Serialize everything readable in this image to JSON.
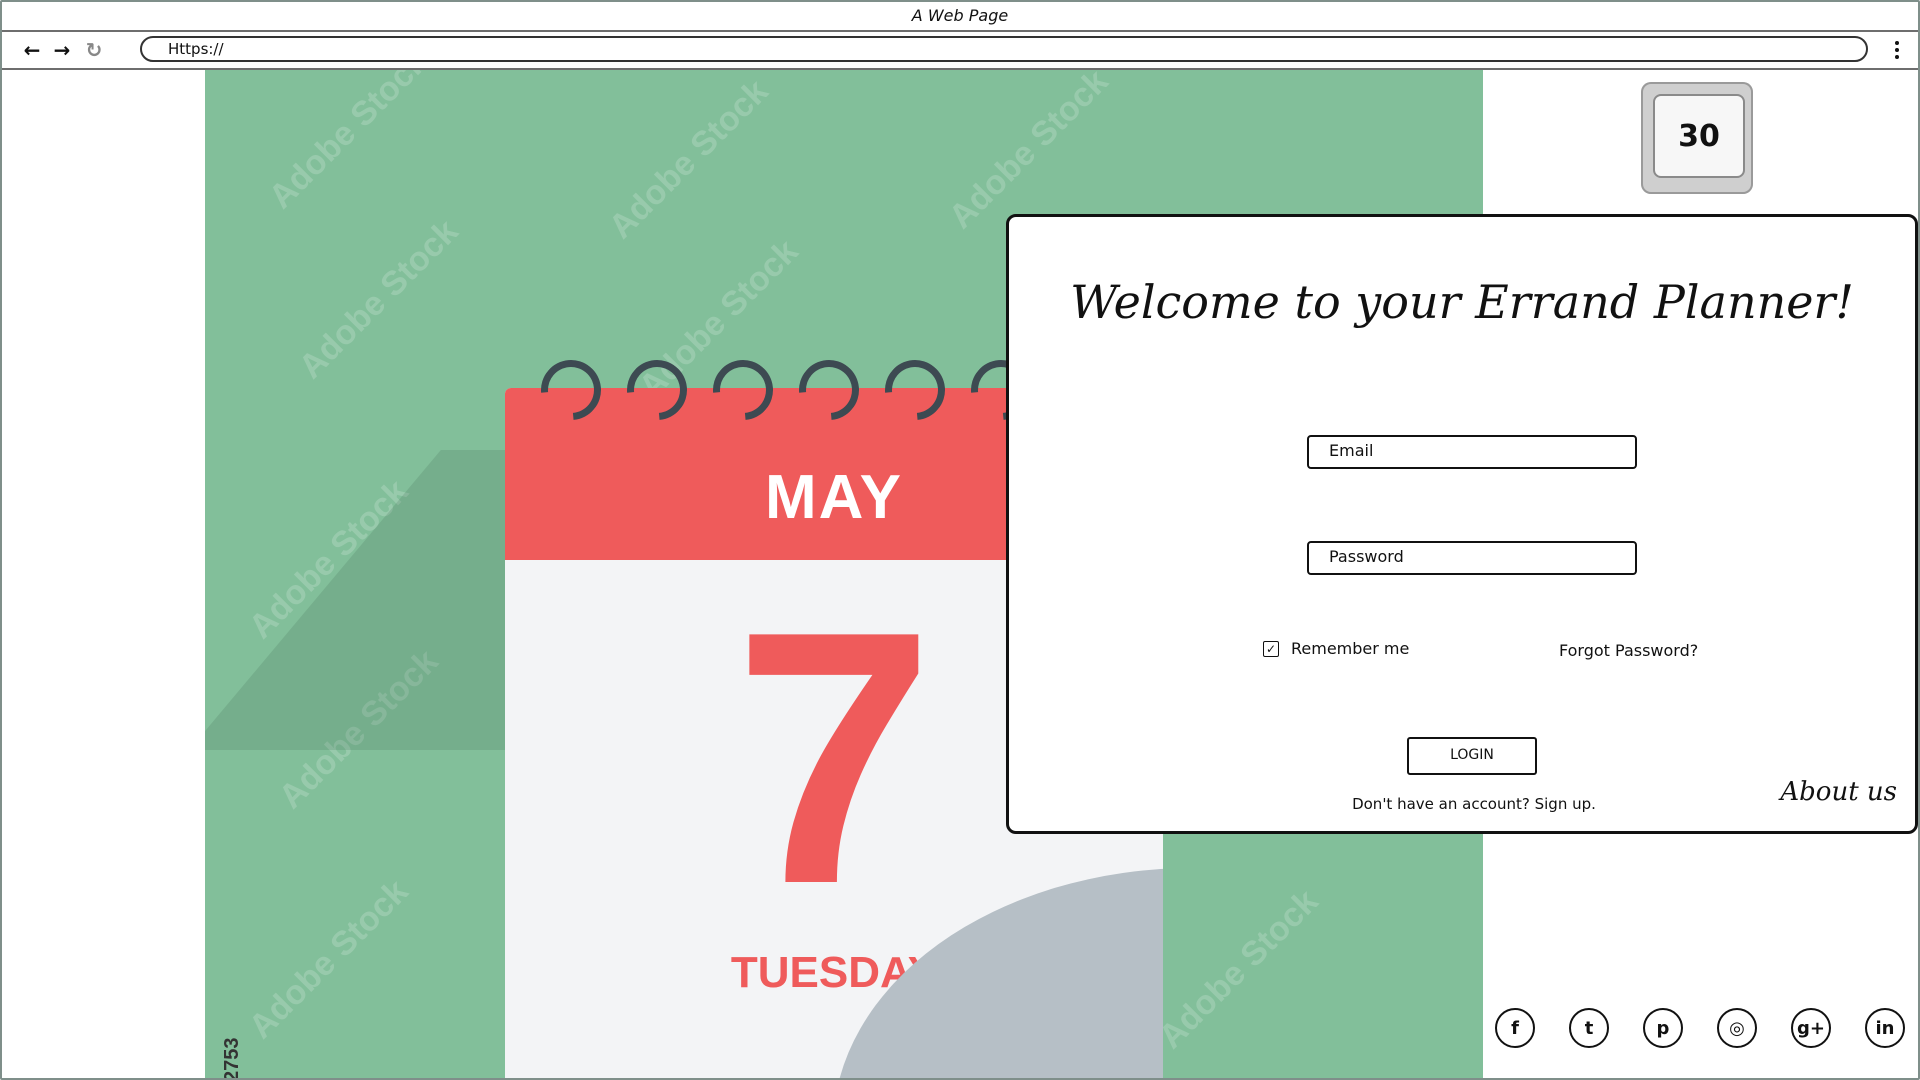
{
  "window": {
    "title": "A Web Page"
  },
  "toolbar": {
    "back_icon": "←",
    "forward_icon": "→",
    "reload_icon": "↻",
    "url": "Https://"
  },
  "hero": {
    "watermark": "Adobe Stock",
    "side_number": "2753",
    "calendar": {
      "month": "MAY",
      "day": "7",
      "weekday": "TUESDAY"
    }
  },
  "logo": {
    "icon": "calendar-30-icon",
    "text": "30"
  },
  "login": {
    "title": "Welcome to your Errand Planner!",
    "email_placeholder": "Email",
    "password_placeholder": "Password",
    "remember_label": "Remember me",
    "remember_checked": true,
    "forgot_label": "Forgot Password?",
    "login_label": "LOGIN",
    "signup_text": "Don't have an account? Sign up."
  },
  "about": {
    "label": "About us"
  },
  "social": {
    "icons": [
      {
        "name": "facebook-icon",
        "glyph": "f"
      },
      {
        "name": "twitter-icon",
        "glyph": "t"
      },
      {
        "name": "pinterest-icon",
        "glyph": "p"
      },
      {
        "name": "instagram-icon",
        "glyph": "◎"
      },
      {
        "name": "google-plus-icon",
        "glyph": "g+"
      },
      {
        "name": "linkedin-icon",
        "glyph": "in"
      }
    ]
  },
  "colors": {
    "hero_bg": "#82bf9a",
    "calendar_red": "#ef5b5b",
    "ring": "#3d4a52"
  }
}
